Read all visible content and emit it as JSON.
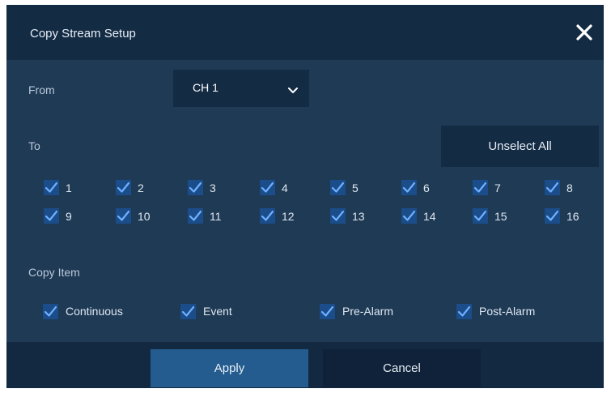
{
  "dialog": {
    "title": "Copy Stream Setup",
    "close_icon": "close-icon"
  },
  "from": {
    "label": "From",
    "selected": "CH 1"
  },
  "to": {
    "label": "To",
    "unselect_all_label": "Unselect All",
    "channels": [
      {
        "label": "1",
        "checked": true
      },
      {
        "label": "2",
        "checked": true
      },
      {
        "label": "3",
        "checked": true
      },
      {
        "label": "4",
        "checked": true
      },
      {
        "label": "5",
        "checked": true
      },
      {
        "label": "6",
        "checked": true
      },
      {
        "label": "7",
        "checked": true
      },
      {
        "label": "8",
        "checked": true
      },
      {
        "label": "9",
        "checked": true
      },
      {
        "label": "10",
        "checked": true
      },
      {
        "label": "11",
        "checked": true
      },
      {
        "label": "12",
        "checked": true
      },
      {
        "label": "13",
        "checked": true
      },
      {
        "label": "14",
        "checked": true
      },
      {
        "label": "15",
        "checked": true
      },
      {
        "label": "16",
        "checked": true
      }
    ]
  },
  "copy_item": {
    "label": "Copy Item",
    "items": [
      {
        "label": "Continuous",
        "checked": true
      },
      {
        "label": "Event",
        "checked": true
      },
      {
        "label": "Pre-Alarm",
        "checked": true
      },
      {
        "label": "Post-Alarm",
        "checked": true
      }
    ]
  },
  "footer": {
    "apply_label": "Apply",
    "cancel_label": "Cancel"
  },
  "colors": {
    "dialog_bg": "#1f3a55",
    "header_bg": "#142b44",
    "checkbox_bg": "#1a4d8a",
    "check_mark": "#6fb0ff",
    "apply_bg": "#245c8f"
  }
}
